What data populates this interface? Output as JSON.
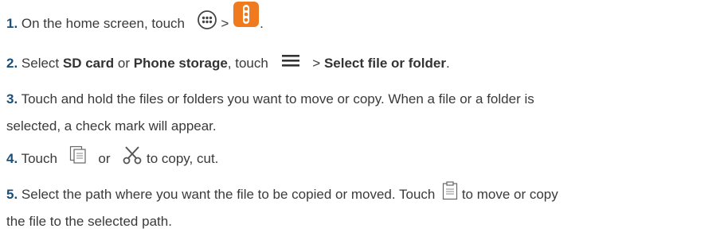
{
  "steps": [
    {
      "num": "1.",
      "text_a": " On the home screen, touch ",
      "sep": " > ",
      "text_b": ".",
      "icons": [
        "apps-grid-icon",
        "file-manager-app-icon"
      ]
    },
    {
      "num": "2.",
      "text_a": " Select ",
      "bold_a": "SD card",
      "text_b": " or ",
      "bold_b": "Phone storage",
      "text_c": ", touch ",
      "text_d": " > ",
      "bold_c": "Select file or folder",
      "text_e": ".",
      "icons": [
        "menu-icon"
      ]
    },
    {
      "num": "3.",
      "line1": " Touch and hold the files or folders you want to move or copy. When a file or a folder is",
      "line2": "selected, a check mark will appear."
    },
    {
      "num": "4.",
      "text_a": " Touch ",
      "text_b": " or ",
      "text_c": " to copy, cut.",
      "icons": [
        "copy-icon",
        "cut-icon"
      ]
    },
    {
      "num": "5.",
      "line1_a": " Select the path where you want the file to be copied or moved. Touch ",
      "line1_b": " to move or copy",
      "line2": "the file to the selected path.",
      "icons": [
        "paste-icon"
      ]
    }
  ],
  "colors": {
    "text": "#3a3a3a",
    "step_number": "#1a4f7a",
    "app_icon": "#f07a1e"
  }
}
